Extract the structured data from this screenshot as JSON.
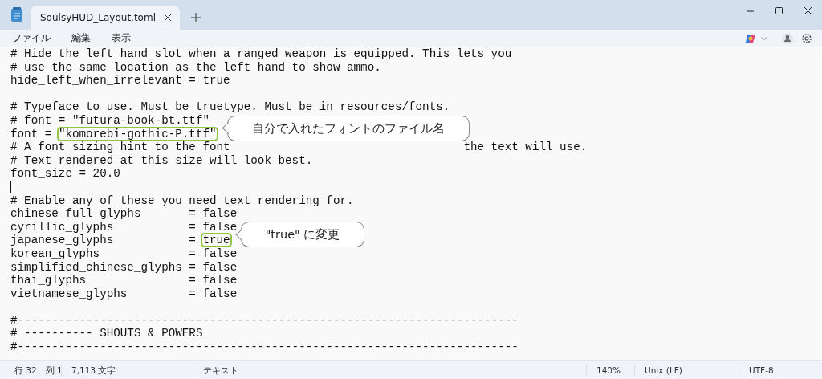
{
  "tab": {
    "title": "SoulsyHUD_Layout.toml",
    "selected": true
  },
  "menu": [
    "ファイル",
    "編集",
    "表示"
  ],
  "editor": {
    "lines": [
      {
        "kind": "text",
        "text": "# Hide the left hand slot when a ranged weapon is equipped. This lets you"
      },
      {
        "kind": "text",
        "text": "# use the same location as the left hand to show ammo."
      },
      {
        "kind": "text",
        "text": "hide_left_when_irrelevant = true"
      },
      {
        "kind": "blank"
      },
      {
        "kind": "text",
        "text": "# Typeface to use. Must be truetype. Must be in resources/fonts."
      },
      {
        "kind": "text",
        "text": "# font = \"futura-book-bt.ttf\""
      },
      {
        "kind": "marked",
        "before": "font = ",
        "marked": "\"komorebi-gothic-P.ttf\"",
        "callout": "自分で入れたフォントのファイル名"
      },
      {
        "kind": "split",
        "before": "# A font sizing hint to the font",
        "after": "the text will use."
      },
      {
        "kind": "text",
        "text": "# Text rendered at this size will look best."
      },
      {
        "kind": "text",
        "text": "font_size = 20.0"
      },
      {
        "kind": "caret"
      },
      {
        "kind": "text",
        "text": "# Enable any of these you need text rendering for."
      },
      {
        "kind": "text",
        "text": "chinese_full_glyphs       = false"
      },
      {
        "kind": "text",
        "text": "cyrillic_glyphs           = false"
      },
      {
        "kind": "marked",
        "before": "japanese_glyphs           = ",
        "marked": "true",
        "callout": "\"true\" に変更"
      },
      {
        "kind": "text",
        "text": "korean_glyphs             = false"
      },
      {
        "kind": "text",
        "text": "simplified_chinese_glyphs = false"
      },
      {
        "kind": "text",
        "text": "thai_glyphs               = false"
      },
      {
        "kind": "text",
        "text": "vietnamese_glyphs         = false"
      },
      {
        "kind": "blank"
      },
      {
        "kind": "text",
        "text": "#-------------------------------------------------------------------------"
      },
      {
        "kind": "text",
        "text": "# ---------- SHOUTS & POWERS"
      },
      {
        "kind": "text",
        "text": "#-------------------------------------------------------------------------"
      }
    ]
  },
  "status_bar": [
    "行 32、列 1",
    "7,113 文字",
    "テキスト",
    "140%",
    "Unix (LF)",
    "UTF-8"
  ]
}
